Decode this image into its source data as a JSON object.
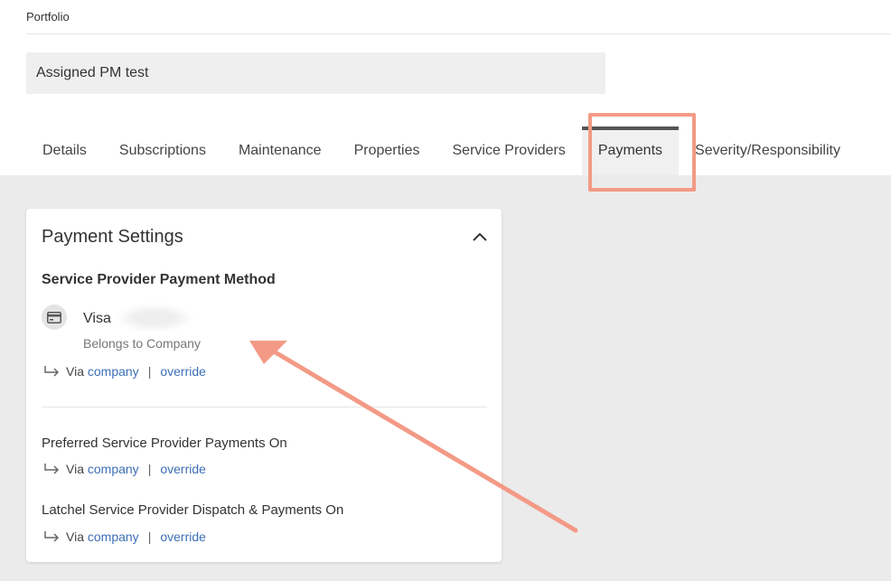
{
  "header": {
    "breadcrumb": "Portfolio",
    "portfolio_name": "Assigned PM test"
  },
  "tabs": [
    {
      "label": "Details",
      "active": false
    },
    {
      "label": "Subscriptions",
      "active": false
    },
    {
      "label": "Maintenance",
      "active": false
    },
    {
      "label": "Properties",
      "active": false
    },
    {
      "label": "Service Providers",
      "active": false
    },
    {
      "label": "Payments",
      "active": true
    },
    {
      "label": "Severity/Responsibility",
      "active": false
    }
  ],
  "card": {
    "title": "Payment Settings",
    "section_heading": "Service Provider Payment Method",
    "payment_method": {
      "brand": "Visa",
      "owner": "Belongs to Company",
      "via": "Via",
      "via_link": "company",
      "override": "override"
    },
    "settings": [
      {
        "label": "Preferred Service Provider Payments On",
        "via": "Via",
        "via_link": "company",
        "override": "override"
      },
      {
        "label": "Latchel Service Provider Dispatch & Payments On",
        "via": "Via",
        "via_link": "company",
        "override": "override"
      }
    ]
  },
  "colors": {
    "highlight": "#f39a86",
    "link": "#3d6fb6",
    "active_tab_bar": "#555555"
  }
}
